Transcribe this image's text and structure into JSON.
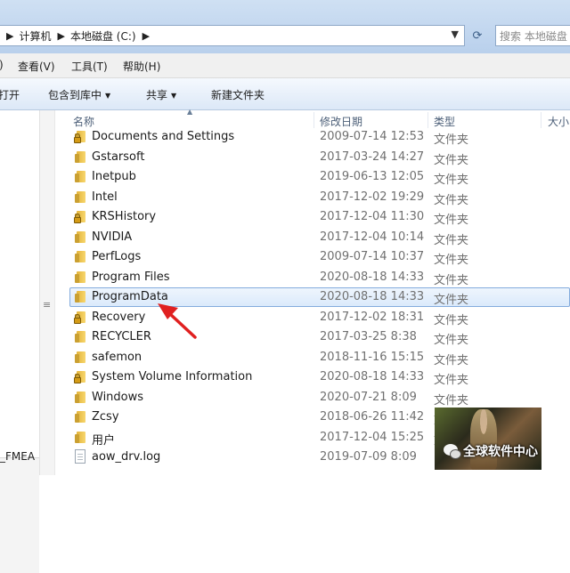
{
  "address": {
    "crumbs": [
      "计算机",
      "本地磁盘 (C:)"
    ],
    "separator": "▶",
    "dropdown_glyph": "▼",
    "refresh_glyph": "⟳"
  },
  "search": {
    "placeholder": "搜索 本地磁盘"
  },
  "menu": {
    "items": [
      "查看(V)",
      "工具(T)",
      "帮助(H)"
    ],
    "leading_fragment": ")"
  },
  "toolbar": {
    "items": [
      {
        "label": "打开",
        "dropdown": false
      },
      {
        "label": "包含到库中",
        "dropdown": true
      },
      {
        "label": "共享",
        "dropdown": true
      },
      {
        "label": "新建文件夹",
        "dropdown": false
      }
    ]
  },
  "columns": {
    "name": "名称",
    "date": "修改日期",
    "type": "类型",
    "size": "大小"
  },
  "files": [
    {
      "name": "Documents and Settings",
      "date": "2009-07-14 12:53",
      "type": "文件夹",
      "icon": "locked-folder-icon"
    },
    {
      "name": "Gstarsoft",
      "date": "2017-03-24 14:27",
      "type": "文件夹",
      "icon": "folder-icon"
    },
    {
      "name": "Inetpub",
      "date": "2019-06-13 12:05",
      "type": "文件夹",
      "icon": "folder-icon"
    },
    {
      "name": "Intel",
      "date": "2017-12-02 19:29",
      "type": "文件夹",
      "icon": "folder-icon"
    },
    {
      "name": "KRSHistory",
      "date": "2017-12-04 11:30",
      "type": "文件夹",
      "icon": "locked-folder-icon"
    },
    {
      "name": "NVIDIA",
      "date": "2017-12-04 10:14",
      "type": "文件夹",
      "icon": "folder-icon"
    },
    {
      "name": "PerfLogs",
      "date": "2009-07-14 10:37",
      "type": "文件夹",
      "icon": "folder-icon"
    },
    {
      "name": "Program Files",
      "date": "2020-08-18 14:33",
      "type": "文件夹",
      "icon": "folder-icon"
    },
    {
      "name": "ProgramData",
      "date": "2020-08-18 14:33",
      "type": "文件夹",
      "icon": "folder-icon",
      "selected": true
    },
    {
      "name": "Recovery",
      "date": "2017-12-02 18:31",
      "type": "文件夹",
      "icon": "locked-folder-icon"
    },
    {
      "name": "RECYCLER",
      "date": "2017-03-25 8:38",
      "type": "文件夹",
      "icon": "folder-icon"
    },
    {
      "name": "safemon",
      "date": "2018-11-16 15:15",
      "type": "文件夹",
      "icon": "folder-icon"
    },
    {
      "name": "System Volume Information",
      "date": "2020-08-18 14:33",
      "type": "文件夹",
      "icon": "locked-folder-icon"
    },
    {
      "name": "Windows",
      "date": "2020-07-21 8:09",
      "type": "文件夹",
      "icon": "folder-icon"
    },
    {
      "name": "Zcsy",
      "date": "2018-06-26 11:42",
      "type": "文件夹",
      "icon": "folder-icon"
    },
    {
      "name": "用户",
      "date": "2017-12-04 15:25",
      "type": "文件夹",
      "icon": "folder-icon"
    },
    {
      "name": "aow_drv.log",
      "date": "2019-07-09 8:09",
      "type": "",
      "icon": "file-icon"
    }
  ],
  "nav": {
    "visible_fragment": "_FMEA"
  },
  "watermark": {
    "text": "全球软件中心"
  },
  "colors": {
    "selection_border": "#84acdd",
    "arrow": "#e02020",
    "folder": "#f0c850"
  }
}
